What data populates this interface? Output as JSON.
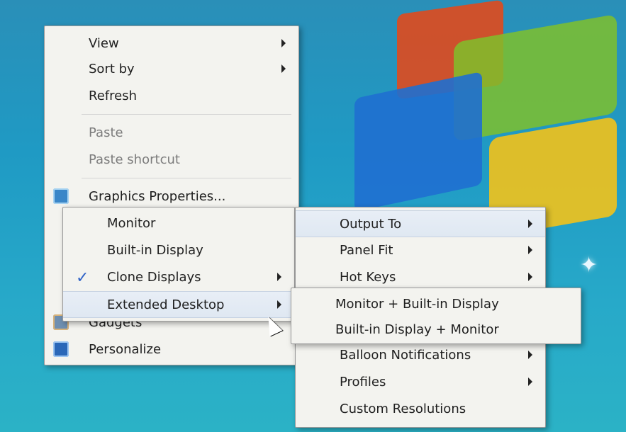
{
  "main_menu": {
    "items": [
      {
        "label": "View",
        "has_submenu": true,
        "disabled": false
      },
      {
        "label": "Sort by",
        "has_submenu": true,
        "disabled": false
      },
      {
        "label": "Refresh",
        "has_submenu": false,
        "disabled": false
      },
      {
        "label": "Paste",
        "has_submenu": false,
        "disabled": true
      },
      {
        "label": "Paste shortcut",
        "has_submenu": false,
        "disabled": true
      },
      {
        "label": "Graphics Properties...",
        "has_submenu": false,
        "disabled": false,
        "icon": "graphics-properties-icon"
      },
      {
        "label": "Gadgets",
        "has_submenu": false,
        "disabled": false,
        "icon": "gadgets-icon"
      },
      {
        "label": "Personalize",
        "has_submenu": false,
        "disabled": false,
        "icon": "personalize-icon"
      }
    ]
  },
  "display_submenu": {
    "items": [
      {
        "label": "Monitor",
        "has_submenu": false,
        "checked": false
      },
      {
        "label": "Built-in Display",
        "has_submenu": false,
        "checked": false
      },
      {
        "label": "Clone Displays",
        "has_submenu": true,
        "checked": true
      },
      {
        "label": "Extended Desktop",
        "has_submenu": true,
        "checked": false,
        "highlighted": true
      }
    ]
  },
  "intel_submenu": {
    "items": [
      {
        "label": "Output To",
        "has_submenu": true,
        "highlighted": true
      },
      {
        "label": "Panel Fit",
        "has_submenu": true
      },
      {
        "label": "Hot Keys",
        "has_submenu": true
      },
      {
        "label": "Balloon Notifications",
        "has_submenu": true
      },
      {
        "label": "Profiles",
        "has_submenu": true
      },
      {
        "label": "Custom Resolutions",
        "has_submenu": false
      }
    ]
  },
  "extended_submenu": {
    "items": [
      {
        "label": "Monitor + Built-in Display"
      },
      {
        "label": "Built-in Display + Monitor"
      }
    ]
  },
  "desktop": {
    "accent_color": "#2a8fb8",
    "flag_colors": [
      "#e04a1d",
      "#7fbf2b",
      "#1f6fd0",
      "#f2c21a"
    ]
  }
}
